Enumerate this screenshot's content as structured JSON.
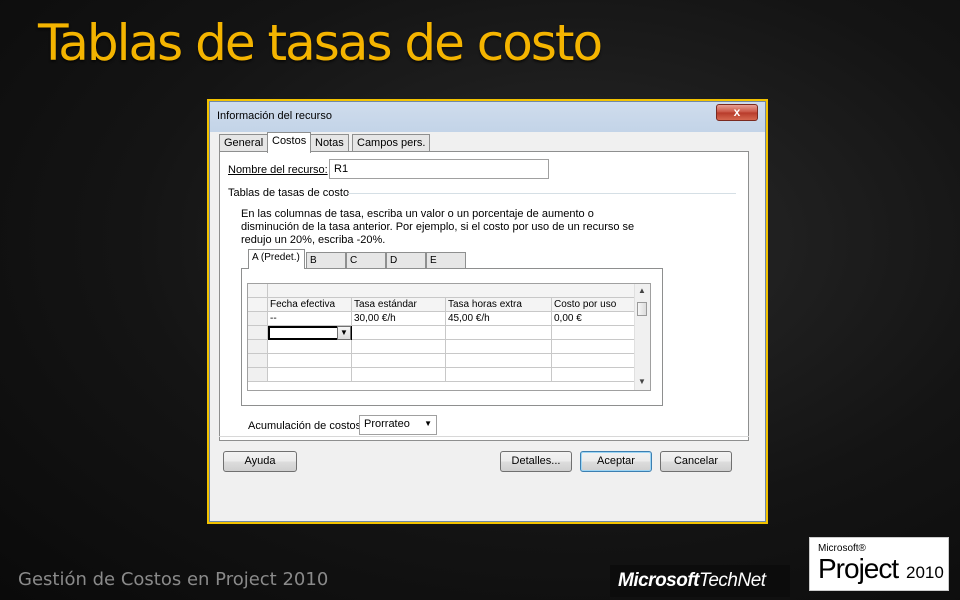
{
  "slide": {
    "title": "Tablas de tasas de costo",
    "footer": "Gestión de Costos en Project 2010"
  },
  "logos": {
    "technet_bold": "Microsoft",
    "technet_thin": "TechNet",
    "project_ms": "Microsoft®",
    "project_name": "Project",
    "project_year": "2010"
  },
  "dialog": {
    "title": "Información del recurso",
    "close": "x",
    "tabs": [
      "General",
      "Costos",
      "Notas",
      "Campos pers."
    ],
    "resource_name_label": "Nombre del recurso:",
    "resource_name_value": "R1",
    "group_label": "Tablas de tasas de costo",
    "instructions": "En las columnas de tasa, escriba un valor o un porcentaje de aumento o disminución de la tasa anterior. Por ejemplo, si el costo por uso de un recurso se redujo un 20%, escriba -20%.",
    "rate_tabs": [
      "A (Predet.)",
      "B",
      "C",
      "D",
      "E"
    ],
    "table": {
      "headers": [
        "Fecha efectiva",
        "Tasa estándar",
        "Tasa horas extra",
        "Costo por uso"
      ],
      "rows": [
        [
          "--",
          "30,00 €/h",
          "45,00 €/h",
          "0,00 €"
        ]
      ]
    },
    "accrual_label": "Acumulación de costos:",
    "accrual_value": "Prorrateo",
    "buttons": {
      "help": "Ayuda",
      "details": "Detalles...",
      "ok": "Aceptar",
      "cancel": "Cancelar"
    }
  }
}
